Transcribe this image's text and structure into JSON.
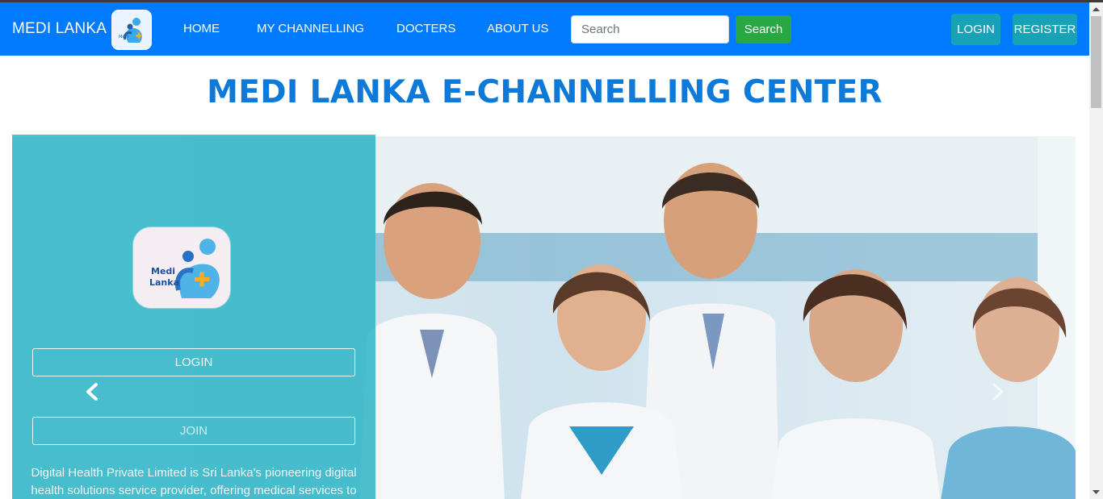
{
  "navbar": {
    "brand": "MEDI LANKA",
    "links": [
      "HOME",
      "MY CHANNELLING",
      "DOCTERS",
      "ABOUT US"
    ],
    "search": {
      "placeholder": "Search",
      "value": "",
      "button_label": "Search"
    },
    "login_label": "LOGIN",
    "register_label": "REGISTER"
  },
  "page": {
    "title": "MEDI LANKA E-CHANNELLING CENTER"
  },
  "panel": {
    "logo_text_line1": "Medi",
    "logo_text_line2": "Lanka",
    "login_label": "LOGIN",
    "join_label": "JOIN",
    "description": "Digital Health Private Limited is Sri Lanka's pioneering digital health solutions service provider, offering medical services to"
  },
  "carousel": {
    "prev_icon": "chevron-left-icon",
    "next_icon": "chevron-right-icon"
  },
  "colors": {
    "navbar": "#007bff",
    "title": "#0d7ad9",
    "search_button": "#28a745",
    "auth_button": "#17a2b8",
    "panel_overlay": "#22b2c4"
  }
}
